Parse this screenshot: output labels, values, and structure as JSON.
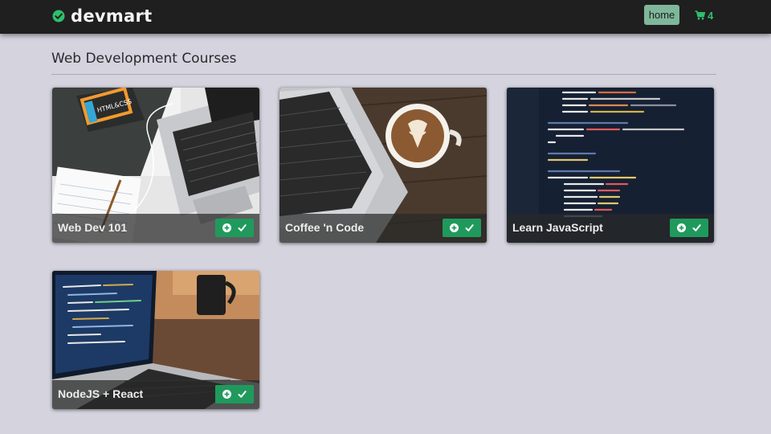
{
  "navbar": {
    "brand": "devmart",
    "brand_icon": "check-circle-icon",
    "home_label": "home",
    "cart_icon": "shopping-cart-icon",
    "cart_count": "4"
  },
  "colors": {
    "navbar_bg": "#1f1f1f",
    "page_bg": "#d4d3de",
    "accent_green": "#1f9a5c",
    "home_button": "#7fb79a"
  },
  "section": {
    "title": "Web Development Courses"
  },
  "courses": [
    {
      "title": "Web Dev 101",
      "image": "laptop-desk-html-css-book-photo",
      "add_icon": "plus-circle-icon",
      "check_icon": "checkmark-icon"
    },
    {
      "title": "Coffee 'n Code",
      "image": "laptop-latte-coffee-photo",
      "add_icon": "plus-circle-icon",
      "check_icon": "checkmark-icon"
    },
    {
      "title": "Learn JavaScript",
      "image": "javascript-code-screen-photo",
      "add_icon": "plus-circle-icon",
      "check_icon": "checkmark-icon"
    },
    {
      "title": "NodeJS + React",
      "image": "laptop-code-mug-photo",
      "add_icon": "plus-circle-icon",
      "check_icon": "checkmark-icon"
    }
  ]
}
